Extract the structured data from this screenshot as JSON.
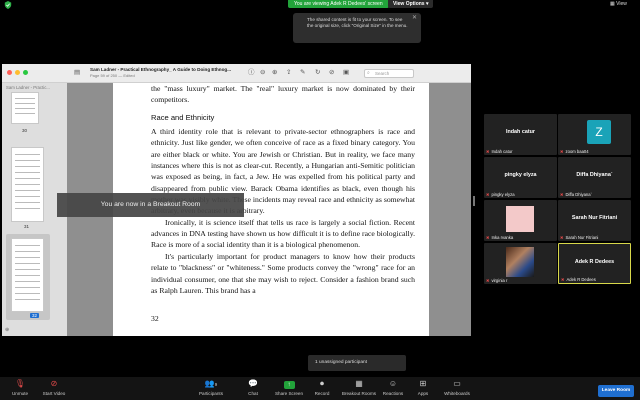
{
  "topbar": {
    "viewing_text": "You are viewing Adek R Dedees' screen",
    "view_options_label": "View Options ▾",
    "view_label": "View"
  },
  "toast": {
    "text": "The shared content is fit to your screen. To see the original size, click \"Original Size\" in the menu."
  },
  "pdf": {
    "title": "Sam Ladner - Practical Ethnography_ A Guide to Doing Ethnog...",
    "subtitle": "Page 59 of 250 — Edited",
    "search_placeholder": "Search",
    "sidebar_header": "Sam Ladner - Practic...",
    "thumbnails": [
      "30",
      "31",
      "32"
    ],
    "page": {
      "para1": "the \"mass luxury\" market. The \"real\" luxury market is now dominated by their competitors.",
      "heading": "Race and Ethnicity",
      "para2": "A third identity role that is relevant to private-sector ethnographers is race and ethnicity. Just like gender, we often conceive of race as a fixed binary category. You are either black or white. You are Jewish or Christian. But in reality, we face many instances where this is not as clear-cut. Recently, a Hungarian anti-Semitic politician was exposed as being, in fact, a Jew. He was expelled from his political party and disappeared from public view. Barack Obama identifies as black, even though his mother was visibly white. These incidents may reveal race and ethnicity as somewhat arbitrary, even because it is arbitrary.",
      "para3": "Ironically, it is science itself that tells us race is largely a social fiction. Recent advances in DNA testing have shown us how difficult it is to define race biologically. Race is more of a social identity than it is a biological phenomenon.",
      "para4": "It's particularly important for product managers to know how their products relate to \"blackness\" or \"whiteness.\" Some products convey the \"wrong\" race for an individual consumer, one that she may wish to reject. Consider a fashion brand such as Ralph Lauren. This brand has a",
      "page_number": "32"
    }
  },
  "breakout_notice": "You are now in a Breakout Room",
  "participants": [
    {
      "display": "Indah catur",
      "label": "Indah catur",
      "avatar": ""
    },
    {
      "display": "Z",
      "label": "zoom baa04",
      "avatar": "#1aa3b8"
    },
    {
      "display": "pingky elyza",
      "label": "pingky elyza",
      "avatar": ""
    },
    {
      "display": "Diffa Dhiyana`",
      "label": "Diffa Dhiyana`",
      "avatar": ""
    },
    {
      "display": "",
      "label": "Inka rvanka",
      "avatar": "#f3c9c9"
    },
    {
      "display": "Sarah Nur Fitriani",
      "label": "Sarah Nur Fitriani",
      "avatar": ""
    },
    {
      "display": "",
      "label": "virginia r",
      "avatar": "photo"
    },
    {
      "display": "Adek R Dedees",
      "label": "Adek R Dedees",
      "avatar": ""
    }
  ],
  "unassigned_text": "1 unassigned participant",
  "bottombar": {
    "unmute": "Unmute",
    "start_video": "Start Video",
    "participants": "Participants",
    "participants_count": "9",
    "chat": "Chat",
    "share_screen": "Share Screen",
    "record": "Record",
    "breakout_rooms": "Breakout Rooms",
    "reactions": "Reactions",
    "apps": "Apps",
    "whiteboards": "Whiteboards",
    "leave": "Leave Room"
  },
  "colors": {
    "share_green": "#22a33a",
    "active_speaker": "#d8d84a",
    "leave_blue": "#1f6fd1",
    "mute_red": "#e24a4a"
  }
}
